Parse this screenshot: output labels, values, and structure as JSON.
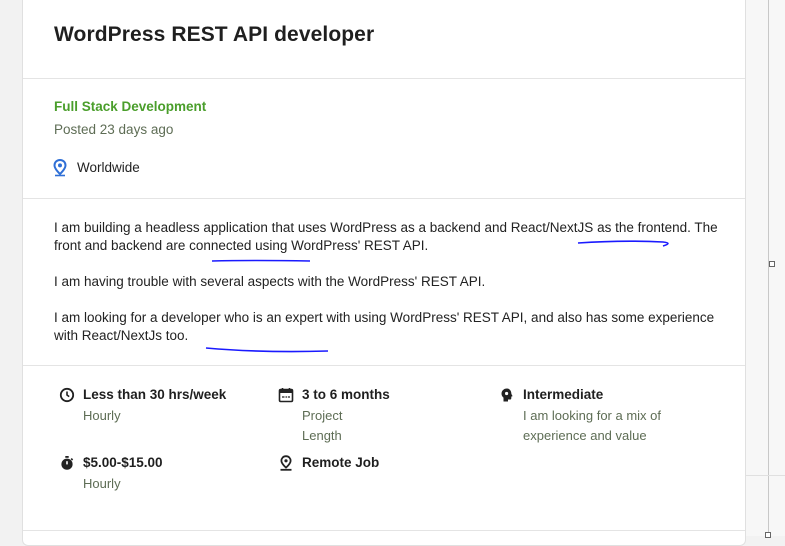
{
  "job": {
    "title": "WordPress REST API developer",
    "category": "Full Stack Development",
    "posted": "Posted 23 days ago",
    "location": "Worldwide"
  },
  "description": {
    "p1_before_react": "I am building a headless application that uses WordPress as a backend and ",
    "p1_react": "React/NextJS",
    "p1_after_react": " as the frontend. The front and ",
    "p1_backend": "backend",
    "p1_end": " are connected using WordPress' REST API.",
    "p2": "I am having trouble with several aspects with the WordPress' REST API.",
    "p3_before": "I am looking for a developer who is an expert with using WordPress' REST API, and also has some experience with ",
    "p3_react": "React/NextJs too."
  },
  "details": {
    "hours": {
      "title": "Less than 30 hrs/week",
      "sub": "Hourly",
      "icon": "clock-icon"
    },
    "length": {
      "title": "3 to 6 months",
      "sub": "Project Length",
      "icon": "calendar-icon"
    },
    "level": {
      "title": "Intermediate",
      "sub": "I am looking for a mix of experience and value",
      "icon": "brain-icon"
    },
    "rate": {
      "title": "$5.00-$15.00",
      "sub": "Hourly",
      "icon": "stopwatch-icon"
    },
    "remote": {
      "title": "Remote Job",
      "sub": "",
      "icon": "location-pin-icon"
    }
  },
  "colors": {
    "category_green": "#4a9e2b",
    "muted_text": "#5e6d55",
    "annotation_blue": "#1a1aff",
    "location_icon_blue": "#2f6fd6"
  }
}
